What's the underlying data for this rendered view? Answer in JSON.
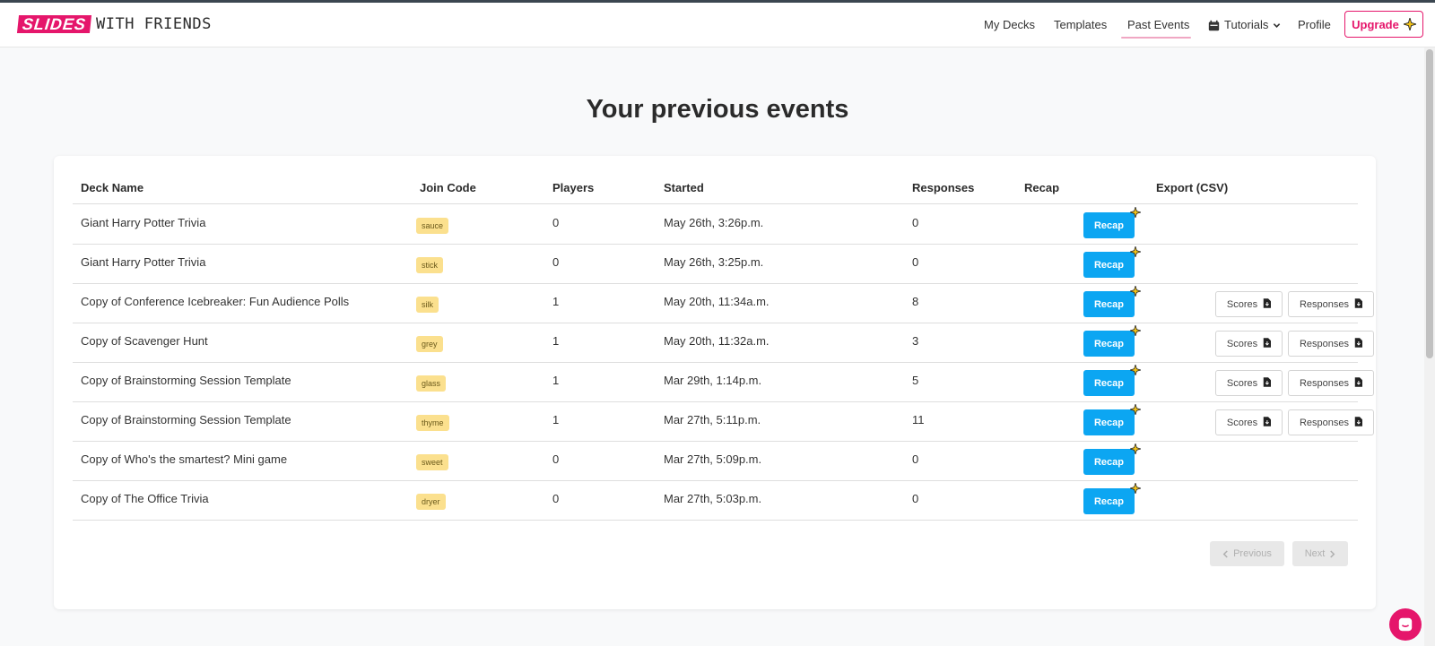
{
  "nav": {
    "logo_part1": "SLIDES",
    "logo_part2": "WITH FRIENDS",
    "my_decks": "My Decks",
    "templates": "Templates",
    "past_events": "Past Events",
    "tutorials": "Tutorials",
    "profile": "Profile",
    "upgrade": "Upgrade"
  },
  "page": {
    "title": "Your previous events"
  },
  "table": {
    "headers": {
      "deck_name": "Deck Name",
      "join_code": "Join Code",
      "players": "Players",
      "started": "Started",
      "responses": "Responses",
      "recap": "Recap",
      "export": "Export (CSV)"
    },
    "recap_label": "Recap",
    "scores_label": "Scores",
    "responses_label": "Responses",
    "rows": [
      {
        "deck": "Giant Harry Potter Trivia",
        "code": "sauce",
        "players": "0",
        "started": "May 26th, 3:26p.m.",
        "responses": "0",
        "export": false
      },
      {
        "deck": "Giant Harry Potter Trivia",
        "code": "stick",
        "players": "0",
        "started": "May 26th, 3:25p.m.",
        "responses": "0",
        "export": false
      },
      {
        "deck": "Copy of Conference Icebreaker: Fun Audience Polls",
        "code": "silk",
        "players": "1",
        "started": "May 20th, 11:34a.m.",
        "responses": "8",
        "export": true
      },
      {
        "deck": "Copy of Scavenger Hunt",
        "code": "grey",
        "players": "1",
        "started": "May 20th, 11:32a.m.",
        "responses": "3",
        "export": true
      },
      {
        "deck": "Copy of Brainstorming Session Template",
        "code": "glass",
        "players": "1",
        "started": "Mar 29th, 1:14p.m.",
        "responses": "5",
        "export": true
      },
      {
        "deck": "Copy of Brainstorming Session Template",
        "code": "thyme",
        "players": "1",
        "started": "Mar 27th, 5:11p.m.",
        "responses": "11",
        "export": true
      },
      {
        "deck": "Copy of Who's the smartest? Mini game",
        "code": "sweet",
        "players": "0",
        "started": "Mar 27th, 5:09p.m.",
        "responses": "0",
        "export": false
      },
      {
        "deck": "Copy of The Office Trivia",
        "code": "dryer",
        "players": "0",
        "started": "Mar 27th, 5:03p.m.",
        "responses": "0",
        "export": false
      }
    ]
  },
  "pagination": {
    "previous": "Previous",
    "next": "Next"
  },
  "colors": {
    "brand": "#e5166b",
    "recap_button": "#0ca6f2",
    "code_badge": "#fbe08e"
  },
  "icons": {
    "sparkle": "sparkle-icon",
    "file_download": "file-download-icon",
    "chevron_left": "chevron-left-icon",
    "chevron_right": "chevron-right-icon",
    "chat": "chat-icon",
    "calendar": "calendar-icon",
    "chevron_down": "chevron-down-icon"
  }
}
